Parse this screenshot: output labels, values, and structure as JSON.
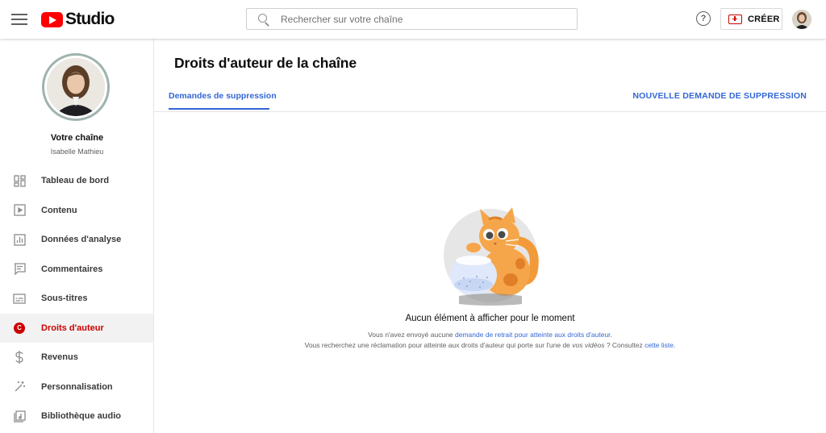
{
  "header": {
    "logo_text": "Studio",
    "search_placeholder": "Rechercher sur votre chaîne",
    "help_glyph": "?",
    "create_label": "CRÉER"
  },
  "sidebar": {
    "channel_title": "Votre chaîne",
    "channel_name": "Isabelle Mathieu",
    "items": [
      {
        "label": "Tableau de bord",
        "icon": "dashboard-icon"
      },
      {
        "label": "Contenu",
        "icon": "content-icon"
      },
      {
        "label": "Données d'analyse",
        "icon": "analytics-icon"
      },
      {
        "label": "Commentaires",
        "icon": "comments-icon"
      },
      {
        "label": "Sous-titres",
        "icon": "subtitles-icon"
      },
      {
        "label": "Droits d'auteur",
        "icon": "copyright-icon",
        "active": true
      },
      {
        "label": "Revenus",
        "icon": "dollar-icon"
      },
      {
        "label": "Personnalisation",
        "icon": "magic-wand-icon"
      },
      {
        "label": "Bibliothèque audio",
        "icon": "audio-library-icon"
      }
    ]
  },
  "main": {
    "title": "Droits d'auteur de la chaîne",
    "tab_label": "Demandes de suppression",
    "new_request_label": "NOUVELLE DEMANDE DE SUPPRESSION",
    "empty": {
      "title": "Aucun élément à afficher pour le moment",
      "line1_prefix": "Vous n'avez envoyé aucune ",
      "line1_link": "demande de retrait pour atteinte aux droits d'auteur",
      "line1_suffix": ".",
      "line2_prefix": "Vous recherchez une réclamation pour atteinte aux droits d'auteur qui porte sur l'une de ",
      "line2_italic": "vos vidéos",
      "line2_middle": " ? Consultez ",
      "line2_link": "cette liste",
      "line2_suffix": "."
    }
  },
  "colors": {
    "brand_red": "#ff0000",
    "link_blue": "#3367d6",
    "active_red": "#cc0000"
  }
}
